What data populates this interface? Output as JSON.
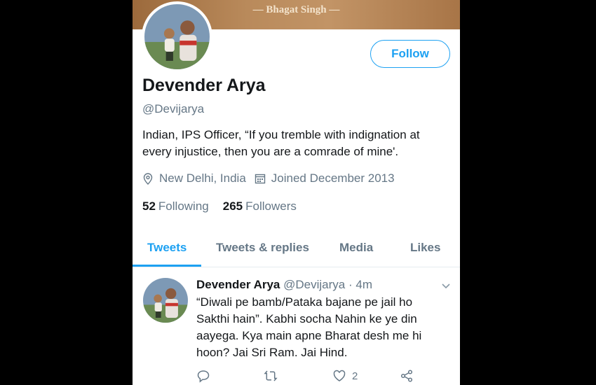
{
  "banner": {
    "quote": "— Bhagat Singh —"
  },
  "profile": {
    "name": "Devender Arya",
    "handle": "@Devijarya",
    "bio": "Indian, IPS Officer, “If you tremble with indignation at every injustice, then you are a comrade of mine'.",
    "location": "New Delhi, India",
    "joined": "Joined December 2013",
    "following_count": "52",
    "following_label": "Following",
    "followers_count": "265",
    "followers_label": "Followers",
    "follow_button": "Follow"
  },
  "tabs": [
    {
      "label": "Tweets",
      "active": true
    },
    {
      "label": "Tweets & replies",
      "active": false
    },
    {
      "label": "Media",
      "active": false
    },
    {
      "label": "Likes",
      "active": false
    }
  ],
  "tweet": {
    "author": "Devender Arya",
    "handle": "@Devijarya",
    "separator": "·",
    "time": "4m",
    "text": "“Diwali pe bamb/Pataka bajane pe jail ho Sakthi hain”. Kabhi socha Nahin ke ye din aayega. Kya main apne Bharat desh me hi hoon? Jai Sri Ram. Jai Hind.",
    "like_count": "2"
  },
  "colors": {
    "accent": "#1da1f2",
    "secondary_text": "#657786",
    "primary_text": "#14171a"
  }
}
